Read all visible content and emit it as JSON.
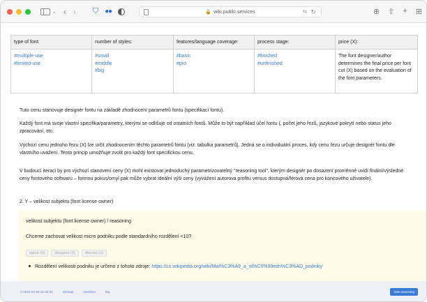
{
  "browser": {
    "url": "wiki.public.services",
    "lock_glyph": "🔒",
    "translate_glyph": "⇆",
    "reload_glyph": "↻"
  },
  "table": {
    "headers": [
      "type of font:",
      "number of styles:",
      "features/language coverage:",
      "process stage:",
      "price (X):"
    ],
    "col_font_types": [
      "#multiple-use",
      "#limited-use"
    ],
    "col_styles": [
      "#small",
      "#middle",
      "#big"
    ],
    "col_features": [
      "#basic",
      "#pro"
    ],
    "col_stage": [
      "#finished",
      "#unfinished"
    ],
    "col_price": "The font designer/author determines the final price per font cut (X) based on the evaluation of the font parameters."
  },
  "paragraphs": [
    "Tuto cenu stanovuje designér fontu na základě zhodnocení parametrů fontu (specifikací fontu).",
    "Každý font má svoje vlastní specifika/parametry, kterými se odlišuje od ostatních fontů. Může to být například účel fontu (, počet jeho řezů, jazykové pokrytí nebo status jeho zpracování, etc.",
    "Výchozí cenu jednoho řezu (X) lze určit zhodnocením těchto parametrů fontu (viz. tabulka parametrů). Jedná se o individuální proces, kdy cenu řezu určuje designér fontu dle vlastního uvážení. Tento princip umožňuje zvolit pro každý font specifickou cenu.",
    "V budoucí iteraci by pro výchozí stanovení ceny (X) mohl existovat jednoduchý parametrizovatelný \"reasoning tool\", kterým designér po dosazení proměnné uvidí finální/výsledné ceny fontového softwaru – formou pokus/omyl pak může vybrat ideální výši ceny (vyvážení autorova profitu versus dostupná/férová cena pro koncového uživatele)."
  ],
  "section_heading": "2. Y – velikost subjektu (font license owner)",
  "callout": {
    "title": "velikost subjektu (font license owner) / reasoning",
    "question": "Chceme zachovat velikost micro podniku podle standardního rozdělení <10?",
    "buttons": [
      "agree (0)",
      "disagree (2)",
      "discuss (1)"
    ],
    "bullet_text": "Rozdělení velikosti podniku je určeno z tohoto zdroje: ",
    "bullet_link": "https://cs.wikipedia.org/wiki/Mal%C3%A9_a_st%C5%99edn%C3%AD_podniky"
  },
  "footer": {
    "version": "V-2022-04-16-12-32-26",
    "links": [
      "sitemap",
      "interface",
      "faq"
    ],
    "hide_button": "hide reasoning"
  },
  "colors": {
    "link": "#3a7bd5",
    "callout_bg": "#fcfbe7",
    "footer_bg": "#eef0f5"
  }
}
